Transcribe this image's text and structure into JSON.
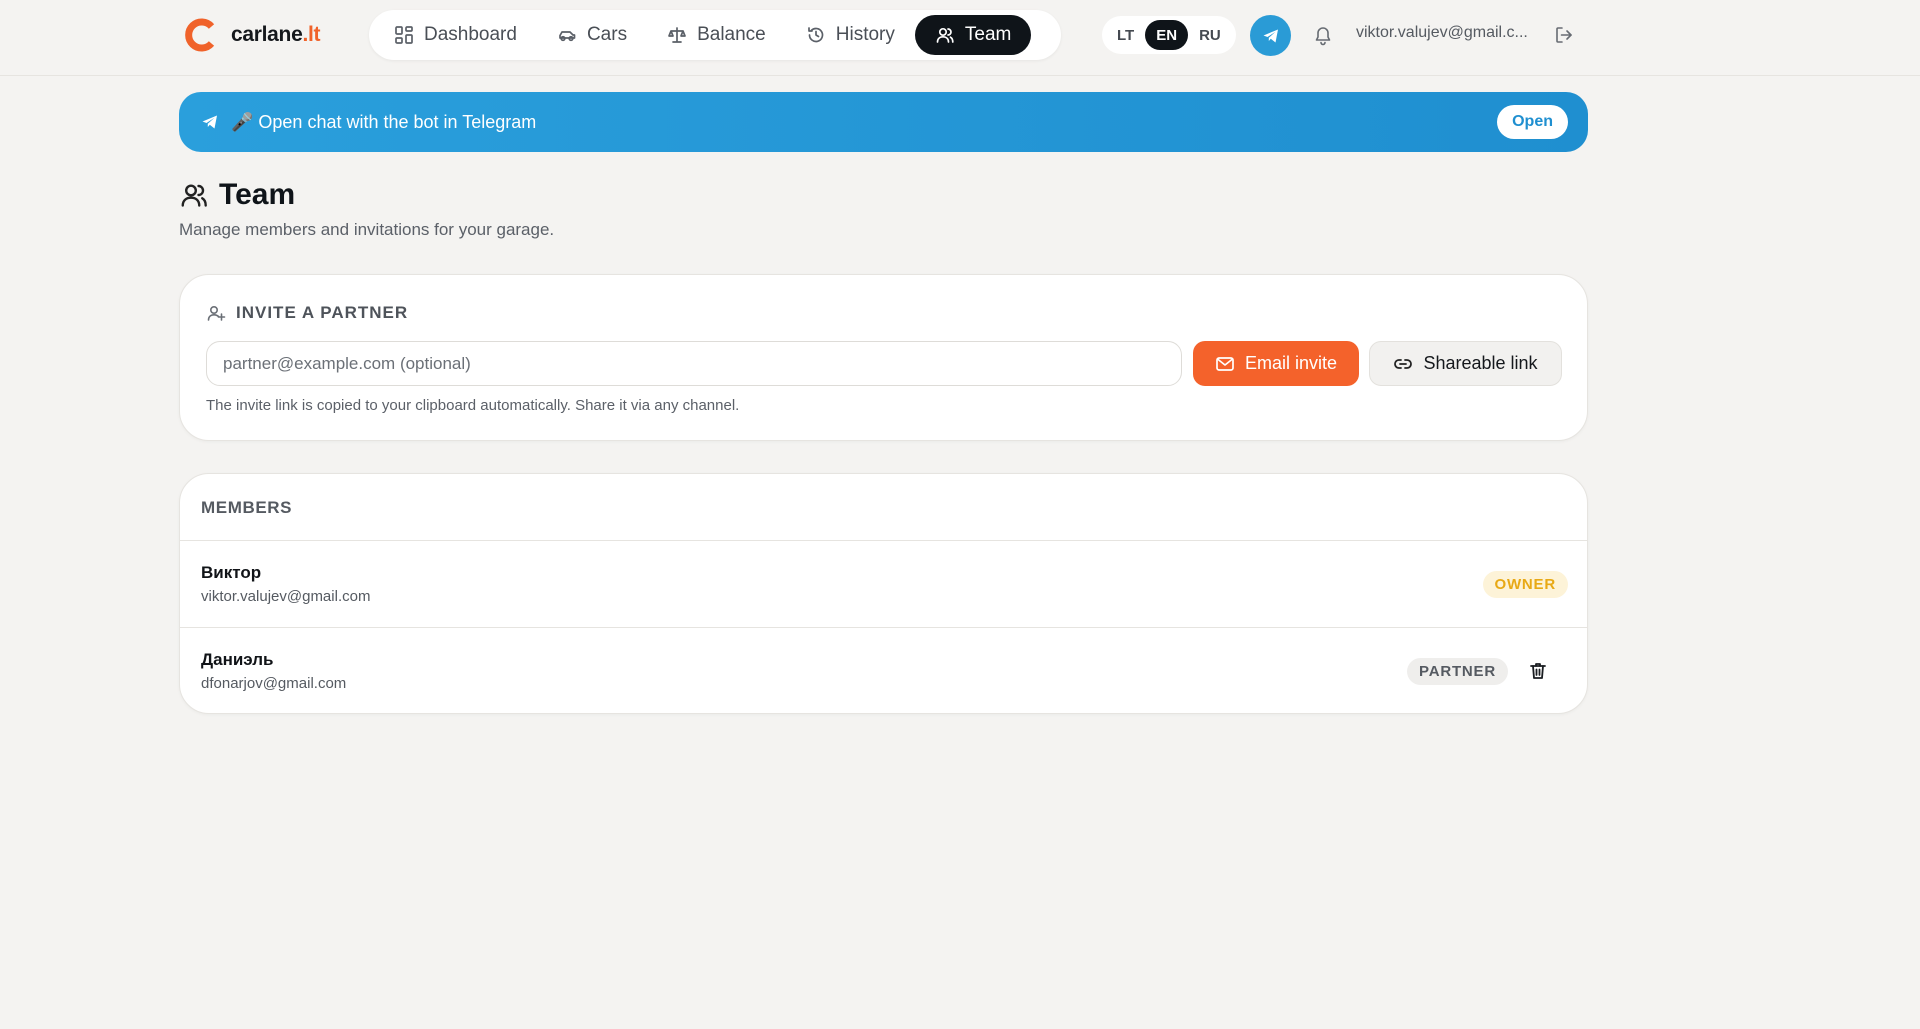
{
  "brand": {
    "name": "carlane",
    "tld": ".lt",
    "accent_color": "#f0622a"
  },
  "nav": {
    "items": [
      {
        "label": "Dashboard",
        "icon": "grid-icon"
      },
      {
        "label": "Cars",
        "icon": "car-icon"
      },
      {
        "label": "Balance",
        "icon": "scale-icon"
      },
      {
        "label": "History",
        "icon": "history-icon"
      },
      {
        "label": "Team",
        "icon": "users-icon",
        "active": true
      }
    ]
  },
  "languages": {
    "items": [
      "LT",
      "EN",
      "RU"
    ],
    "selected": "EN"
  },
  "header": {
    "user_email": "viktor.valujev@gmail.c..."
  },
  "banner": {
    "text": "🎤 Open chat with the bot in Telegram",
    "button_label": "Open",
    "color": "#2a9fdc"
  },
  "page": {
    "title": "Team",
    "subtitle": "Manage members and invitations for your garage."
  },
  "invite": {
    "title": "INVITE A PARTNER",
    "email_placeholder": "partner@example.com (optional)",
    "email_button": "Email invite",
    "link_button": "Shareable link",
    "hint": "The invite link is copied to your clipboard automatically. Share it via any channel."
  },
  "members": {
    "title": "MEMBERS",
    "rows": [
      {
        "name": "Виктор",
        "email": "viktor.valujev@gmail.com",
        "role": "OWNER"
      },
      {
        "name": "Даниэль",
        "email": "dfonarjov@gmail.com",
        "role": "PARTNER"
      }
    ]
  }
}
